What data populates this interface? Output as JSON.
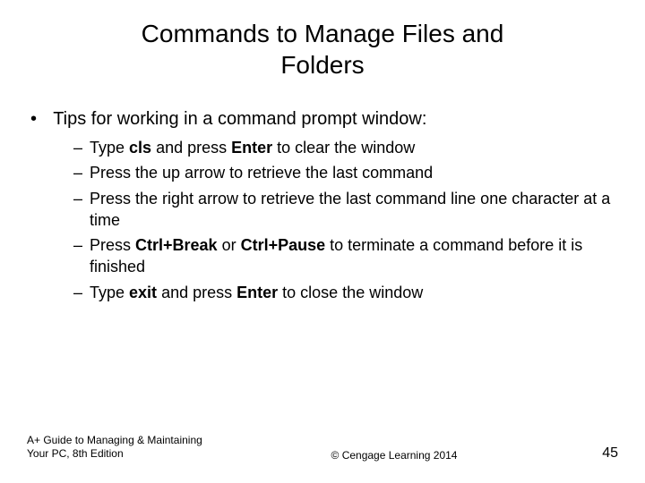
{
  "title_line1": "Commands to Manage Files and",
  "title_line2": "Folders",
  "bullet_main": "Tips for working in a command prompt window:",
  "tips": {
    "t1a": "Type ",
    "t1b": "cls",
    "t1c": " and press ",
    "t1d": "Enter",
    "t1e": " to clear the window",
    "t2": "Press the up arrow to retrieve the last command",
    "t3": "Press the right arrow to retrieve the last command line one character at a time",
    "t4a": "Press ",
    "t4b": "Ctrl+Break",
    "t4c": " or ",
    "t4d": "Ctrl+Pause",
    "t4e": " to terminate a command before it is finished",
    "t5a": "Type ",
    "t5b": "exit",
    "t5c": " and press ",
    "t5d": "Enter",
    "t5e": " to close the window"
  },
  "footer": {
    "left": "A+ Guide to Managing & Maintaining Your PC, 8th Edition",
    "center": "© Cengage Learning  2014",
    "page": "45"
  }
}
